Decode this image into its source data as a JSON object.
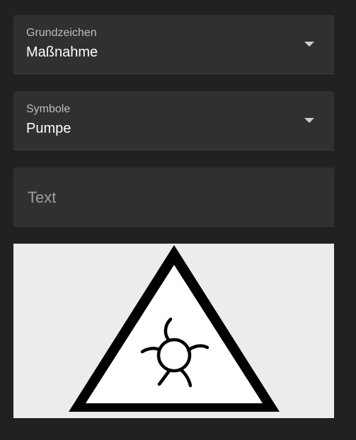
{
  "grundzeichen": {
    "label": "Grundzeichen",
    "value": "Maßnahme",
    "icon": "dropdown-arrow-icon"
  },
  "symbole": {
    "label": "Symbole",
    "value": "Pumpe",
    "icon": "dropdown-arrow-icon"
  },
  "text_field": {
    "placeholder": "Text",
    "value": ""
  },
  "preview": {
    "sign_shape": "triangle",
    "symbol_icon": "pump-icon",
    "colors": {
      "background": "#ececec",
      "sign_fill": "#ffffff",
      "sign_stroke": "#000000"
    }
  }
}
